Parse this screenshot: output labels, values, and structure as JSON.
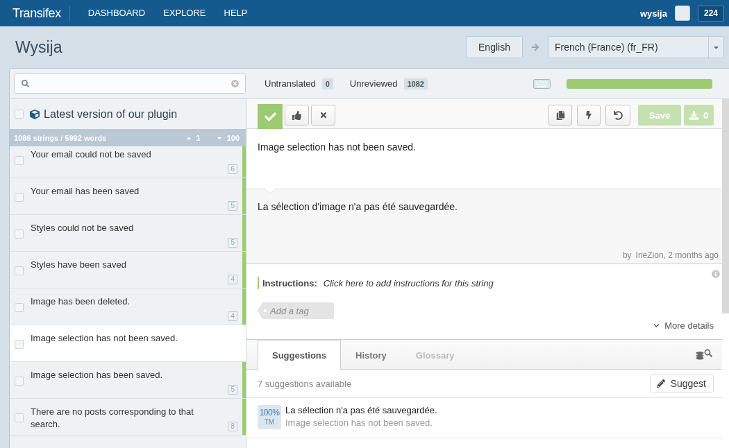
{
  "topbar": {
    "logo": "Transifex",
    "nav": [
      {
        "label": "DASHBOARD"
      },
      {
        "label": "EXPLORE"
      },
      {
        "label": "HELP"
      }
    ],
    "user": "wysija",
    "notifications": "224"
  },
  "header": {
    "title": "Wysija",
    "source_language": "English",
    "target_language": "French (France) (fr_FR)"
  },
  "stats": [
    {
      "label": "Untranslated",
      "count": "0"
    },
    {
      "label": "Unreviewed",
      "count": "1082"
    }
  ],
  "progress": {
    "level": 1
  },
  "group": {
    "label": "Latest version of our plugin",
    "checked": false
  },
  "list_summary": {
    "text": "1086 strings / 5992 words",
    "sort_up": "1",
    "sort_down": "100"
  },
  "strings": [
    {
      "text": "Your email could not be saved",
      "words": "6",
      "checked": false,
      "selected": false,
      "reviewed": true
    },
    {
      "text": "Your email has been saved",
      "words": "5",
      "checked": false,
      "selected": false,
      "reviewed": true
    },
    {
      "text": "Styles could not be saved",
      "words": "5",
      "checked": false,
      "selected": false,
      "reviewed": true
    },
    {
      "text": "Styles have been saved",
      "words": "4",
      "checked": false,
      "selected": false,
      "reviewed": true
    },
    {
      "text": "Image has been deleted.",
      "words": "4",
      "checked": false,
      "selected": false,
      "reviewed": true
    },
    {
      "text": "Image selection has not been saved.",
      "checked": false,
      "selected": true,
      "reviewed": false
    },
    {
      "text": "Image selection has been saved.",
      "words": "5",
      "checked": false,
      "selected": false,
      "reviewed": true
    },
    {
      "text": "There are no posts corresponding to that search.",
      "words": "8",
      "checked": false,
      "selected": false,
      "reviewed": true
    }
  ],
  "toolbar": {
    "review": {
      "on": true
    },
    "save": {
      "label": "Save",
      "disabled": true
    },
    "download": {
      "label": "0",
      "disabled": true
    }
  },
  "source_text": "Image selection has not been saved.",
  "translation": {
    "text": "La sélection d'image n'a pas été sauvegardée.",
    "by": "by",
    "author": "IrieZion, 2 months ago"
  },
  "instructions": {
    "label": "Instructions:",
    "text": "Click here to add instructions for this string"
  },
  "tag_field": {
    "placeholder": "Add a tag"
  },
  "more_details": "More details",
  "tabs": [
    {
      "label": "Suggestions",
      "selected": true,
      "disabled": false
    },
    {
      "label": "History",
      "selected": false,
      "disabled": false
    },
    {
      "label": "Glossary",
      "selected": false,
      "disabled": true
    }
  ],
  "suggestions": {
    "summary": "7 suggestions available",
    "button": "Suggest",
    "items": [
      {
        "score": "100%",
        "origin": "TM",
        "translation": "La sélection n'a pas été sauvegardée.",
        "source": "Image selection has not been saved."
      }
    ]
  }
}
